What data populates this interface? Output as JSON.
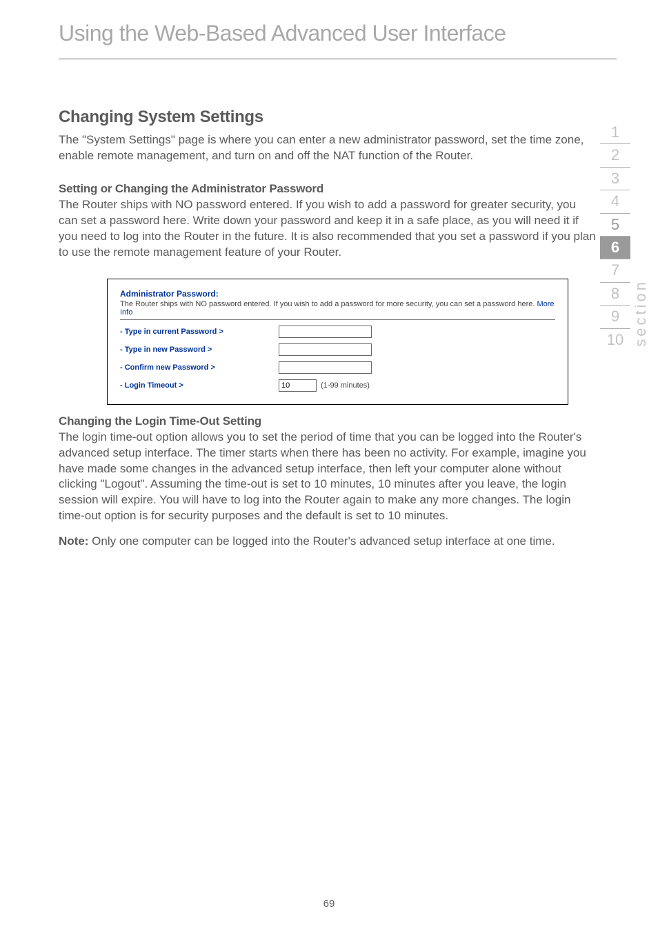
{
  "page_title": "Using the Web-Based Advanced User Interface",
  "section_heading": "Changing System Settings",
  "intro_para": "The \"System Settings\" page is where you can enter a new administrator password, set the time zone, enable remote management, and turn on and off the NAT function of the Router.",
  "sub1_heading": "Setting or Changing the Administrator Password",
  "sub1_para": "The Router ships with NO password entered. If you wish to add a password for greater security, you can set a password here. Write down your password and keep it in a safe place, as you will need it if you need to log into the Router in the future. It is also recommended that you set a password if you plan to use the remote management feature of your Router.",
  "figure": {
    "title": "Administrator Password:",
    "desc_text": "The Router ships with NO password entered. If you wish to add a password for more security, you can set a password here. ",
    "more_info": "More Info",
    "rows": {
      "current": "- Type in current Password >",
      "new": "- Type in new Password >",
      "confirm": "- Confirm new Password >",
      "timeout": "- Login Timeout >"
    },
    "timeout_value": "10",
    "timeout_hint": "(1-99 minutes)"
  },
  "sub2_heading": "Changing the Login Time-Out Setting",
  "sub2_para": "The login time-out option allows you to set the period of time that you can be logged into the Router's advanced setup interface. The timer starts when there has been no activity. For example, imagine you have made some changes in the advanced setup interface, then left your computer alone without clicking \"Logout\". Assuming the time-out is set to 10 minutes, 10 minutes after you leave, the login session will expire. You will have to log into the Router again to make any more changes. The login time-out option is for security purposes and the default is set to 10 minutes.",
  "note_bold": "Note:",
  "note_text": " Only one computer can be logged into the Router's advanced setup interface at one time.",
  "sidetabs": [
    "1",
    "2",
    "3",
    "4",
    "5",
    "6",
    "7",
    "8",
    "9",
    "10"
  ],
  "sidetabs_active_index": 5,
  "side_label": "section",
  "page_number": "69"
}
